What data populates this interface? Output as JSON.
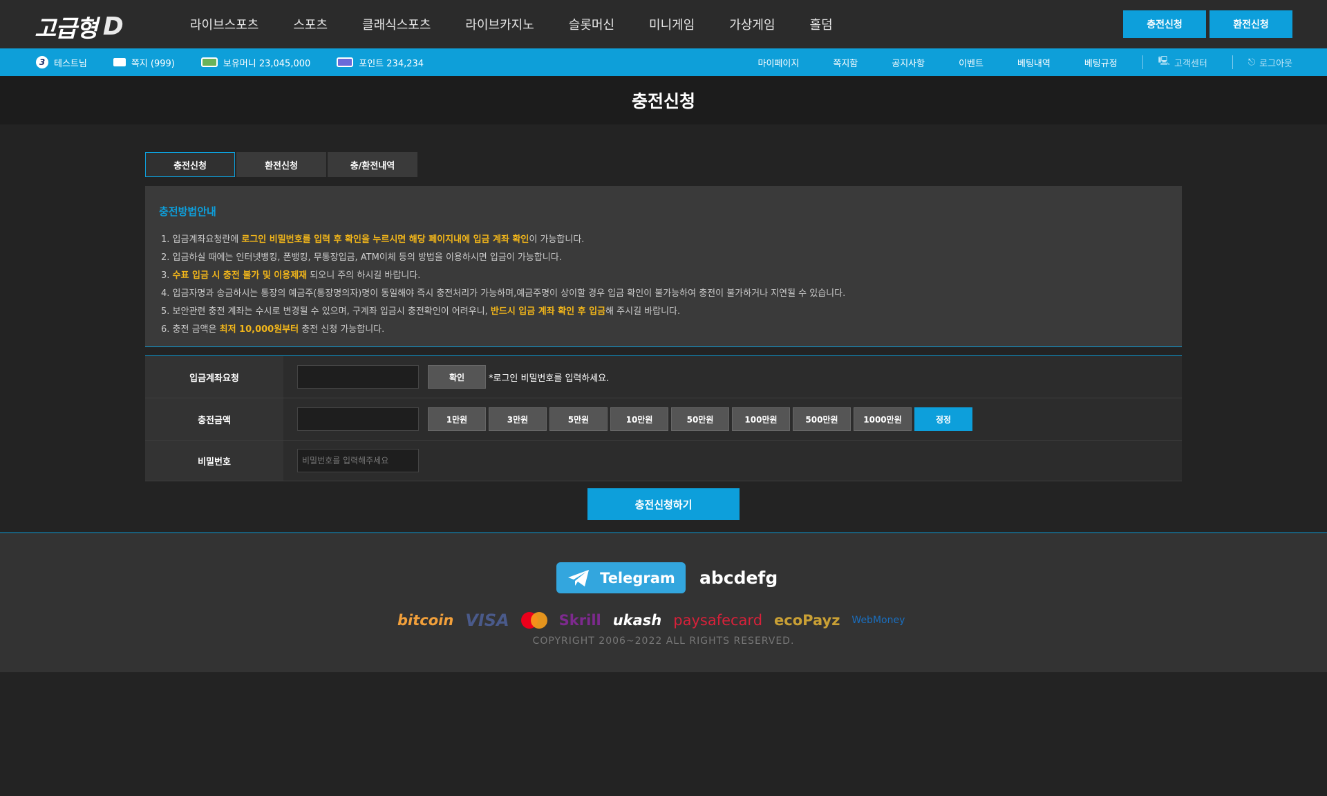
{
  "header": {
    "logo_text": "고급형",
    "logo_suffix": "D",
    "nav": [
      "라이브스포츠",
      "스포츠",
      "클래식스포츠",
      "라이브카지노",
      "슬롯머신",
      "미니게임",
      "가상게임",
      "홀덤"
    ],
    "buttons": {
      "charge": "충전신청",
      "exchange": "환전신청"
    }
  },
  "infobar": {
    "level": "3",
    "username": "테스트님",
    "messages": "쪽지 (999)",
    "money": "보유머니 23,045,000",
    "points": "포인트 234,234",
    "links": [
      "마이페이지",
      "쪽지함",
      "공지사항",
      "이벤트",
      "베팅내역",
      "베팅규정"
    ],
    "support": "고객센터",
    "logout": "로그아웃"
  },
  "page": {
    "title": "충전신청"
  },
  "tabs": [
    "충전신청",
    "환전신청",
    "충/환전내역"
  ],
  "guide": {
    "title": "충전방법안내",
    "l1a": "1. 입금계좌요청란에 ",
    "l1b": "로그인 비밀번호를 입력 후 확인을 누르시면 해당 페이지내에 입금 계좌 확인",
    "l1c": "이 가능합니다.",
    "l2": "2. 입금하실 때에는 인터넷뱅킹, 폰뱅킹, 무통장입금, ATM이체 등의 방법을 이용하시면 입금이 가능합니다.",
    "l3a": "3. ",
    "l3b": "수표 입금 시 충전 불가 및 이용제재",
    "l3c": " 되오니 주의 하시길 바랍니다.",
    "l4": "4. 입금자명과 송금하시는 통장의 예금주(통장명의자)명이 동일해야 즉시 충전처리가 가능하며,예금주명이 상이할 경우 입금 확인이 불가능하여 충전이 불가하거나 지연될 수 있습니다.",
    "l5a": "5. 보안관련 충전 계좌는 수시로 변경될 수 있으며, 구계좌 입금시 충전확인이 어려우니, ",
    "l5b": "반드시 입금 계좌 확인 후 입금",
    "l5c": "해 주시길 바랍니다.",
    "l6a": "6. 충전 금액은 ",
    "l6b": "최저 10,000원부터",
    "l6c": " 충전 신청 가능합니다."
  },
  "form": {
    "account_label": "입금계좌요청",
    "confirm": "확인",
    "account_note": "*로그인 비밀번호를 입력하세요.",
    "amount_label": "충전금액",
    "amounts": [
      "1만원",
      "3만원",
      "5만원",
      "10만원",
      "50만원",
      "100만원",
      "500만원",
      "1000만원"
    ],
    "reset": "정정",
    "password_label": "비밀번호",
    "password_placeholder": "비밀번호를 입력해주세요",
    "submit": "충전신청하기"
  },
  "footer": {
    "telegram": "Telegram",
    "telegram_id": "abcdefg",
    "payments": [
      "bitcoin",
      "VISA",
      "Skrill",
      "ukash",
      "paysafecard",
      "ecoPayz",
      "WebMoney"
    ],
    "copyright": "COPYRIGHT  2006~2022  ALL RIGHTS RESERVED."
  }
}
